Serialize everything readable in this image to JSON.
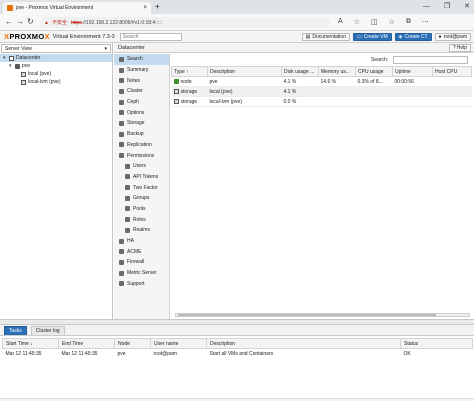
{
  "browser": {
    "tab_title": "pve - Proxmox Virtual Environment",
    "tab_close": "×",
    "new_tab": "+",
    "security_warning": "不安全",
    "url_protocol": "https",
    "url_rest": "://192.168.2.122:8006/#v1:0:18:4:::::",
    "window_controls": [
      "—",
      "❐",
      "✕"
    ],
    "nav": {
      "back": "←",
      "forward": "→",
      "reload": "↻"
    },
    "toolbar_icons": [
      "A",
      "☆",
      "◫",
      "☆",
      "⧉",
      "⋯"
    ]
  },
  "header": {
    "logo_pre": "PROXMO",
    "logo_x": "X",
    "version": "Virtual Environment 7.3-3",
    "search_placeholder": "Search",
    "buttons": {
      "documentation": "Documentation",
      "create_vm": "Create VM",
      "create_ct": "Create CT",
      "user": "root@pam"
    }
  },
  "tree": {
    "view": "Server View",
    "items": [
      {
        "label": "Datacenter",
        "level": 0,
        "type": "dc",
        "selected": true
      },
      {
        "label": "pve",
        "level": 1,
        "type": "node",
        "selected": false
      },
      {
        "label": "local (pve)",
        "level": 2,
        "type": "storage",
        "selected": false
      },
      {
        "label": "local-lvm (pve)",
        "level": 2,
        "type": "storage",
        "selected": false
      }
    ]
  },
  "content": {
    "title": "Datacenter",
    "help": "Help",
    "menu": [
      {
        "label": "Search",
        "sub": false,
        "active": true
      },
      {
        "label": "Summary",
        "sub": false
      },
      {
        "label": "Notes",
        "sub": false
      },
      {
        "label": "Cluster",
        "sub": false
      },
      {
        "label": "Ceph",
        "sub": false
      },
      {
        "label": "Options",
        "sub": false
      },
      {
        "label": "Storage",
        "sub": false
      },
      {
        "label": "Backup",
        "sub": false
      },
      {
        "label": "Replication",
        "sub": false
      },
      {
        "label": "Permissions",
        "sub": false,
        "expandable": true
      },
      {
        "label": "Users",
        "sub": true
      },
      {
        "label": "API Tokens",
        "sub": true
      },
      {
        "label": "Two Factor",
        "sub": true
      },
      {
        "label": "Groups",
        "sub": true
      },
      {
        "label": "Pools",
        "sub": true
      },
      {
        "label": "Roles",
        "sub": true
      },
      {
        "label": "Realms",
        "sub": true
      },
      {
        "label": "HA",
        "sub": false,
        "expandable": true
      },
      {
        "label": "ACME",
        "sub": false
      },
      {
        "label": "Firewall",
        "sub": false,
        "expandable": true
      },
      {
        "label": "Metric Server",
        "sub": false
      },
      {
        "label": "Support",
        "sub": false
      }
    ],
    "search_label": "Search:",
    "columns": [
      "Type ↑",
      "Description",
      "Disk usage ...",
      "Memory us...",
      "CPU usage",
      "Uptime",
      "Host CPU"
    ],
    "rows": [
      {
        "type": "node",
        "description": "pve",
        "disk": "4.1 %",
        "memory": "14.6 %",
        "cpu": "0.3% of 8...",
        "uptime": "00:00:56",
        "host_cpu": ""
      },
      {
        "type": "storage",
        "description": "local (pve)",
        "disk": "4.1 %",
        "memory": "",
        "cpu": "",
        "uptime": "",
        "host_cpu": ""
      },
      {
        "type": "storage",
        "description": "local-lvm (pve)",
        "disk": "0.0 %",
        "memory": "",
        "cpu": "",
        "uptime": "",
        "host_cpu": ""
      }
    ]
  },
  "tasks": {
    "tabs": [
      "Tasks",
      "Cluster log"
    ],
    "columns": [
      "Start Time ↓",
      "End Time",
      "Node",
      "User name",
      "Description",
      "Status"
    ],
    "rows": [
      {
        "start": "Mar 12 11:49:35",
        "end": "Mar 12 11:49:35",
        "node": "pve",
        "user": "root@pam",
        "description": "Start all VMs and Containers",
        "status": "OK"
      }
    ]
  }
}
